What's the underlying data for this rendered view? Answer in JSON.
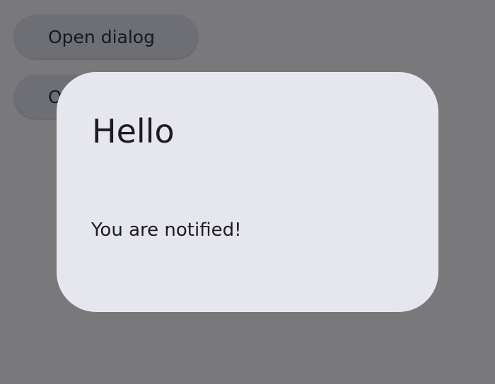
{
  "background": {
    "buttons": [
      {
        "label": "Open dialog"
      },
      {
        "label": "Open dialog"
      }
    ]
  },
  "dialog": {
    "title": "Hello",
    "body": "You are notified!"
  },
  "colors": {
    "page_bg": "#f2f2f7",
    "button_bg": "#dcdee8",
    "button_text": "#22344f",
    "scrim": "#000000",
    "dialog_bg": "#e6e7ee",
    "dialog_text": "#1b1b20"
  }
}
